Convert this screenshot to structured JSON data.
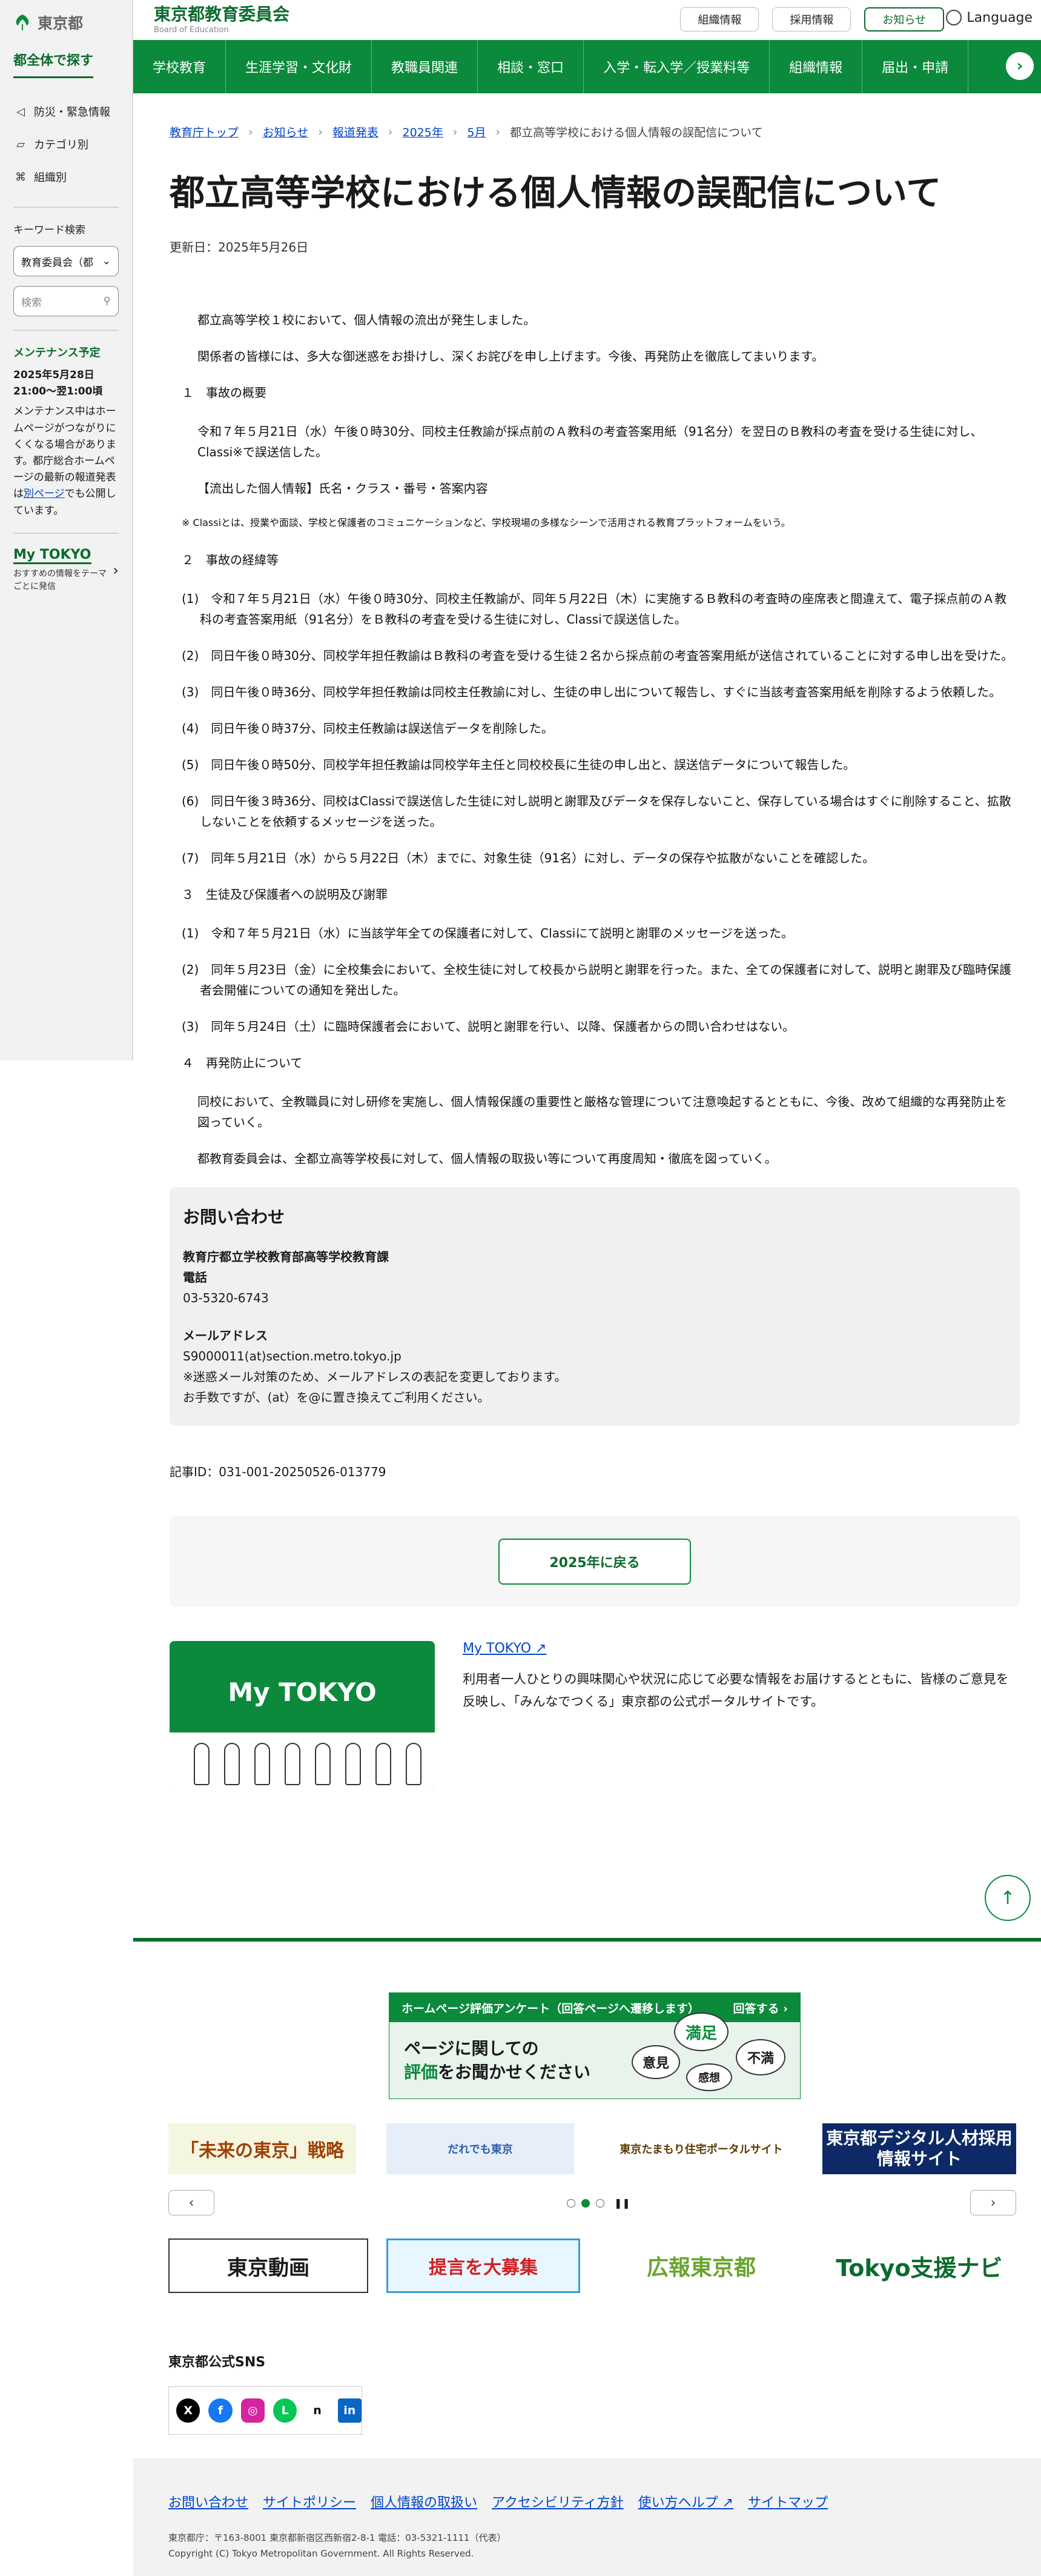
{
  "site": {
    "logo_text": "東京都",
    "header_title": "東京都教育委員会",
    "header_sub": "Board of Education",
    "header_buttons": [
      "組織情報",
      "採用情報",
      "お知らせ"
    ],
    "language_label": "Language"
  },
  "nav": {
    "items": [
      "学校教育",
      "生涯学習・文化財",
      "教職員関連",
      "相談・窓口",
      "入学・転入学／授業料等",
      "組織情報",
      "届出・申請"
    ],
    "next_symbol": "›"
  },
  "sidebar": {
    "heading": "都全体で探す",
    "menu": [
      "防災・緊急情報",
      "カテゴリ別",
      "組織別"
    ],
    "keyword_label": "キーワード検索",
    "select_value": "教育委員会（都",
    "search_placeholder": "検索",
    "maintenance_heading": "メンテナンス予定",
    "maintenance_date": "2025年5月28日 21:00〜翌1:00頃",
    "maintenance_text_1": "メンテナンス中はホームページがつながりにくくなる場合があります。都庁総合ホームページの最新の報道発表は",
    "maintenance_link": "別ページ",
    "maintenance_text_2": "でも公開しています。",
    "mytokyo_label": "My TOKYO",
    "mytokyo_desc": "おすすめの情報をテーマごとに発信"
  },
  "breadcrumb": [
    "教育庁トップ",
    "お知らせ",
    "報道発表",
    "2025年",
    "5月",
    "都立高等学校における個人情報の誤配信について"
  ],
  "page": {
    "title": "都立高等学校における個人情報の誤配信について",
    "updated": "更新日：2025年5月26日"
  },
  "article": {
    "p1": "都立高等学校１校において、個人情報の流出が発生しました。",
    "p2": "関係者の皆様には、多大な御迷惑をお掛けし、深くお詫びを申し上げます。今後、再発防止を徹底してまいります。",
    "h1": "１　事故の概要",
    "p3": "令和７年５月21日（水）午後０時30分、同校主任教諭が採点前のＡ教科の考査答案用紙（91名分）を翌日のＢ教科の考査を受ける生徒に対し、Classi※で誤送信した。",
    "p4": "【流出した個人情報】氏名・クラス・番号・答案内容",
    "note": "※ Classiとは、授業や面談、学校と保護者のコミュニケーションなど、学校現場の多様なシーンで活用される教育プラットフォームをいう。",
    "h2": "２　事故の経緯等",
    "items": [
      "(1)　令和７年５月21日（水）午後０時30分、同校主任教諭が、同年５月22日（木）に実施するＢ教科の考査時の座席表と間違えて、電子採点前のＡ教科の考査答案用紙（91名分）をＢ教科の考査を受ける生徒に対し、Classiで誤送信した。",
      "(2)　同日午後０時30分、同校学年担任教諭はＢ教科の考査を受ける生徒２名から採点前の考査答案用紙が送信されていることに対する申し出を受けた。",
      "(3)　同日午後０時36分、同校学年担任教諭は同校主任教諭に対し、生徒の申し出について報告し、すぐに当該考査答案用紙を削除するよう依頼した。",
      "(4)　同日午後０時37分、同校主任教諭は誤送信データを削除した。",
      "(5)　同日午後０時50分、同校学年担任教諭は同校学年主任と同校校長に生徒の申し出と、誤送信データについて報告した。",
      "(6)　同日午後３時36分、同校はClassiで誤送信した生徒に対し説明と謝罪及びデータを保存しないこと、保存している場合はすぐに削除すること、拡散しないことを依頼するメッセージを送った。",
      "(7)　同年５月21日（水）から５月22日（木）までに、対象生徒（91名）に対し、データの保存や拡散がないことを確認した。"
    ],
    "h3": "３　生徒及び保護者への説明及び謝罪",
    "items2": [
      "(1)　令和７年５月21日（水）に当該学年全ての保護者に対して、Classiにて説明と謝罪のメッセージを送った。",
      "(2)　同年５月23日（金）に全校集会において、全校生徒に対して校長から説明と謝罪を行った。また、全ての保護者に対して、説明と謝罪及び臨時保護者会開催についての通知を発出した。",
      "(3)　同年５月24日（土）に臨時保護者会において、説明と謝罪を行い、以降、保護者からの問い合わせはない。"
    ],
    "h4": "４　再発防止について",
    "p5": "同校において、全教職員に対し研修を実施し、個人情報保護の重要性と厳格な管理について注意喚起するとともに、今後、改めて組織的な再発防止を図っていく。",
    "p6": "都教育委員会は、全都立高等学校長に対して、個人情報の取扱い等について再度周知・徹底を図っていく。"
  },
  "contact": {
    "heading": "お問い合わせ",
    "dept": "教育庁都立学校教育部高等学校教育課",
    "phone_label": "電話",
    "phone": "03-5320-6743",
    "email_label": "メールアドレス",
    "email": "S9000011(at)section.metro.tokyo.jp",
    "email_note_1": "※迷惑メール対策のため、メールアドレスの表記を変更しております。",
    "email_note_2": "お手数ですが、(at）を@に置き換えてご利用ください。"
  },
  "article_id": "記事ID：031-001-20250526-013779",
  "back_button": "2025年に戻る",
  "mytokyo": {
    "brand": "My TOKYO",
    "link": "My TOKYO",
    "desc": "利用者一人ひとりの興味関心や状況に応じて必要な情報をお届けするとともに、皆様のご意見を反映し、「みんなでつくる」東京都の公式ポータルサイトです。"
  },
  "footer": {
    "survey_title": "ホームページ評価アンケート（回答ページへ遷移します）",
    "survey_answer": "回答する",
    "survey_q1": "ページに関しての",
    "survey_q2a": "評価",
    "survey_q2b": "をお聞かせください",
    "bubbles": [
      "満足",
      "意見",
      "不満",
      "感想"
    ],
    "banners": [
      "「未来の東京」戦略",
      "だれでも東京",
      "東京たまもり住宅ポータルサイト",
      "東京都デジタル人材採用情報サイト"
    ],
    "banners2": [
      "東京動画",
      "提言を大募集",
      "広報東京都",
      "Tokyo支援ナビ"
    ],
    "sns_heading": "東京都公式SNS",
    "sns": [
      "X",
      "f",
      "◎",
      "L",
      "n",
      "in"
    ],
    "links": [
      "お問い合わせ",
      "サイトポリシー",
      "個人情報の取扱い",
      "アクセシビリティ方針",
      "使い方ヘルプ",
      "サイトマップ"
    ],
    "address": "東京都庁：〒163-8001 東京都新宿区西新宿2-8-1 電話：03-5321-1111（代表）",
    "copyright": "Copyright (C) Tokyo Metropolitan Government. All Rights Reserved."
  }
}
